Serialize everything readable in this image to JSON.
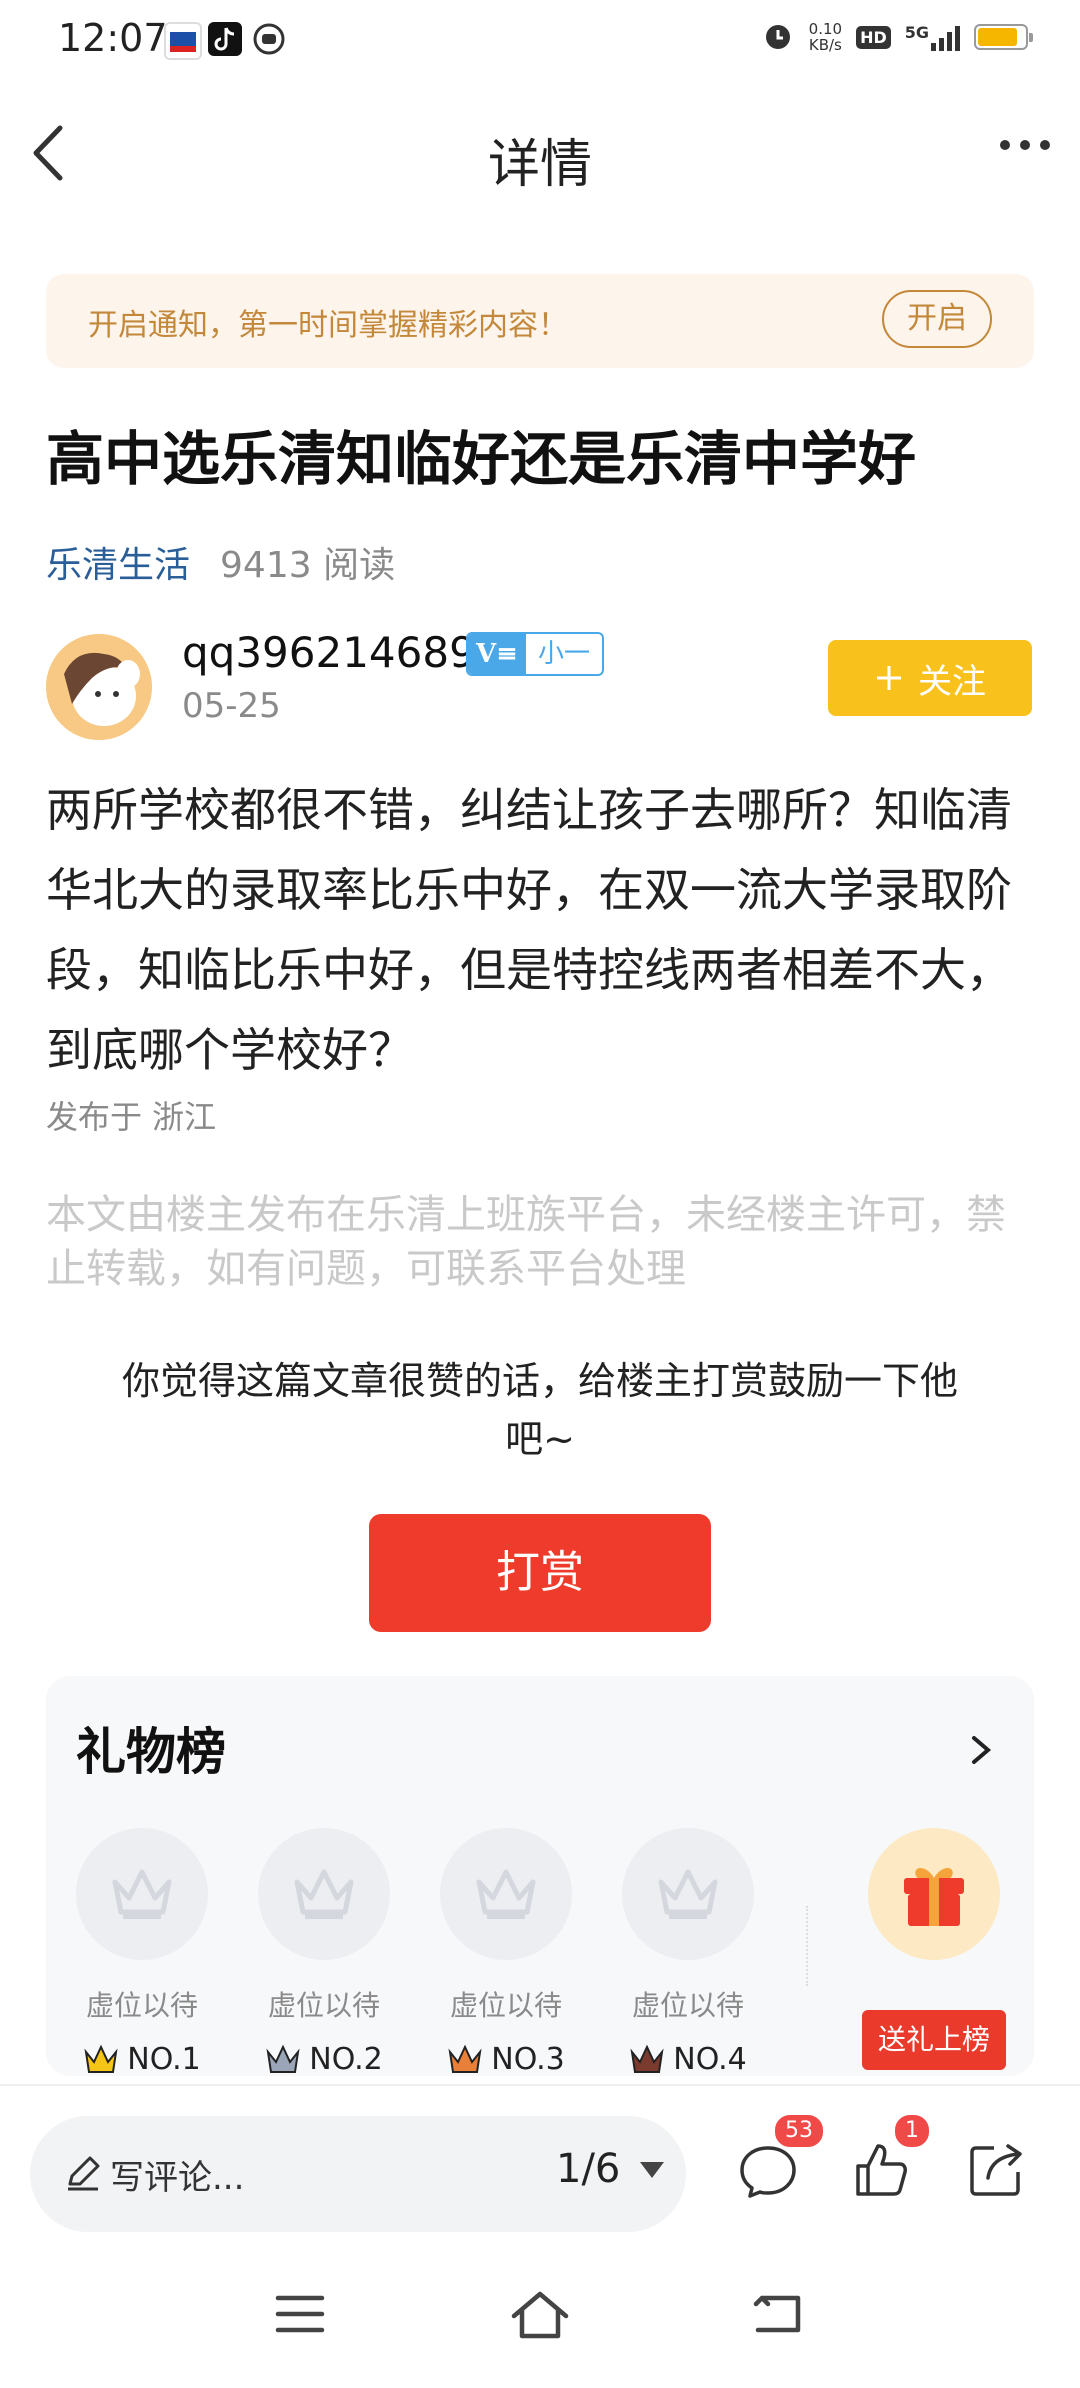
{
  "status_bar": {
    "time": "12:07",
    "net_speed_value": "0.10",
    "net_speed_unit": "KB/s",
    "hd": "HD",
    "network": "5G",
    "battery_level": 0.85,
    "app_icons": [
      "weibo-icon",
      "tiktok-icon",
      "assistant-icon"
    ]
  },
  "header": {
    "title": "详情"
  },
  "notice": {
    "text": "开启通知，第一时间掌握精彩内容！",
    "button": "开启"
  },
  "post": {
    "title": "高中选乐清知临好还是乐清中学好",
    "board": "乐清生活",
    "reads": "9413 阅读",
    "author": {
      "name": "qq396214689",
      "badge_v": "V≡",
      "badge_level": "小一",
      "date": "05-25",
      "follow_label": "关注"
    },
    "content": "两所学校都很不错，纠结让孩子去哪所？知临清华北大的录取率比乐中好，在双一流大学录取阶段，知临比乐中好，但是特控线两者相差不大，到底哪个学校好？",
    "location": "发布于 浙江",
    "copyright": "本文由楼主发布在乐清上班族平台，未经楼主许可，禁止转载，如有问题，可联系平台处理"
  },
  "reward": {
    "text": "你觉得这篇文章很赞的话，给楼主打赏鼓励一下他吧~",
    "button": "打赏"
  },
  "gift_board": {
    "title": "礼物榜",
    "slots": [
      {
        "label": "虚位以待",
        "rank": "NO.1",
        "crown_color": "#f5c518"
      },
      {
        "label": "虚位以待",
        "rank": "NO.2",
        "crown_color": "#9aa6b8"
      },
      {
        "label": "虚位以待",
        "rank": "NO.3",
        "crown_color": "#e8803a"
      },
      {
        "label": "虚位以待",
        "rank": "NO.4",
        "crown_color": "#7a3b2e"
      }
    ],
    "send_button": "送礼上榜"
  },
  "bottom_bar": {
    "comment_placeholder": "写评论...",
    "page_indicator": "1/6",
    "comment_count": "53",
    "like_count": "1"
  },
  "colors": {
    "accent_red": "#ee3b2b",
    "follow_yellow": "#f8c11c",
    "link_blue": "#2a5e98",
    "notice_gold": "#c4883a"
  }
}
